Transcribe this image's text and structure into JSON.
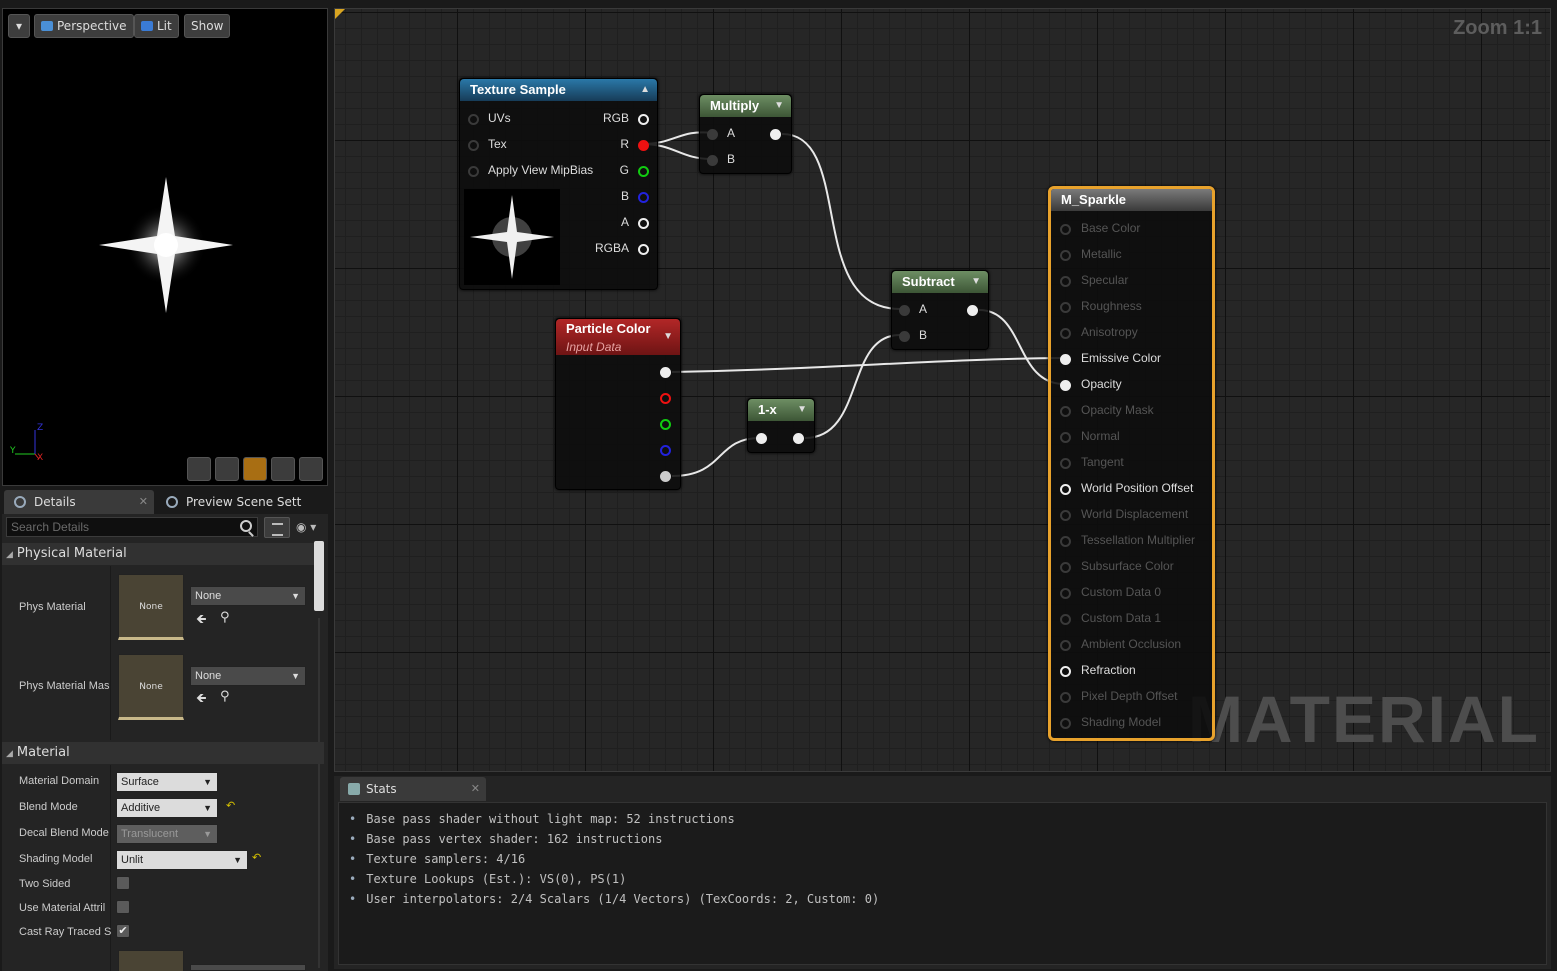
{
  "viewport": {
    "menu_label": "▾",
    "perspective_label": "Perspective",
    "lit_label": "Lit",
    "show_label": "Show",
    "axis_y": "Y",
    "axis_x": "X",
    "axis_z": "Z"
  },
  "details_panel": {
    "tabs": [
      {
        "label": "Details",
        "close": "✕"
      },
      {
        "label": "Preview Scene Sett"
      }
    ],
    "search_placeholder": "Search Details",
    "categories": {
      "physical_material": "Physical Material",
      "material": "Material"
    },
    "phys_material": {
      "label": "Phys Material",
      "thumb": "None",
      "value": "None"
    },
    "phys_material_mask": {
      "label": "Phys Material Mas",
      "thumb": "None",
      "value": "None"
    },
    "material_domain": {
      "label": "Material Domain",
      "value": "Surface"
    },
    "blend_mode": {
      "label": "Blend Mode",
      "value": "Additive"
    },
    "decal_blend_mode": {
      "label": "Decal Blend Mode",
      "value": "Translucent"
    },
    "shading_model": {
      "label": "Shading Model",
      "value": "Unlit"
    },
    "two_sided": {
      "label": "Two Sided",
      "checked": false
    },
    "use_material_attr": {
      "label": "Use Material Attril",
      "checked": false
    },
    "cast_ray_traced": {
      "label": "Cast Ray Traced S",
      "checked": true
    }
  },
  "graph": {
    "zoom": "Zoom 1:1",
    "watermark": "MATERIAL",
    "nodes": {
      "texture_sample": {
        "title": "Texture Sample",
        "inputs": [
          "UVs",
          "Tex",
          "Apply View MipBias"
        ],
        "outputs": [
          "RGB",
          "R",
          "G",
          "B",
          "A",
          "RGBA"
        ]
      },
      "multiply": {
        "title": "Multiply",
        "inputs": [
          "A",
          "B"
        ]
      },
      "particle_color": {
        "title": "Particle Color",
        "subtitle": "Input Data"
      },
      "one_minus": {
        "title": "1-x"
      },
      "subtract": {
        "title": "Subtract",
        "inputs": [
          "A",
          "B"
        ]
      },
      "result": {
        "title": "M_Sparkle",
        "pins": [
          {
            "label": "Base Color",
            "active": false
          },
          {
            "label": "Metallic",
            "active": false
          },
          {
            "label": "Specular",
            "active": false
          },
          {
            "label": "Roughness",
            "active": false
          },
          {
            "label": "Anisotropy",
            "active": false
          },
          {
            "label": "Emissive Color",
            "active": true,
            "connected": true
          },
          {
            "label": "Opacity",
            "active": true,
            "connected": true
          },
          {
            "label": "Opacity Mask",
            "active": false
          },
          {
            "label": "Normal",
            "active": false
          },
          {
            "label": "Tangent",
            "active": false
          },
          {
            "label": "World Position Offset",
            "active": true,
            "connected": false
          },
          {
            "label": "World Displacement",
            "active": false
          },
          {
            "label": "Tessellation Multiplier",
            "active": false
          },
          {
            "label": "Subsurface Color",
            "active": false
          },
          {
            "label": "Custom Data 0",
            "active": false
          },
          {
            "label": "Custom Data 1",
            "active": false
          },
          {
            "label": "Ambient Occlusion",
            "active": false
          },
          {
            "label": "Refraction",
            "active": true,
            "connected": false
          },
          {
            "label": "Pixel Depth Offset",
            "active": false
          },
          {
            "label": "Shading Model",
            "active": false
          }
        ]
      }
    }
  },
  "stats": {
    "tab_label": "Stats",
    "close": "✕",
    "lines": [
      "Base pass shader without light map: 52 instructions",
      "Base pass vertex shader: 162 instructions",
      "Texture samplers: 4/16",
      "Texture Lookups (Est.): VS(0), PS(1)",
      "User interpolators: 2/4 Scalars (1/4 Vectors) (TexCoords: 2, Custom: 0)"
    ]
  },
  "colors": {
    "texture_header": "#1f5e86",
    "math_header": "#4c6e45",
    "particle_header": "#8e1c1c",
    "result_header": "#4c4c4c",
    "selection": "#e8a22c"
  }
}
